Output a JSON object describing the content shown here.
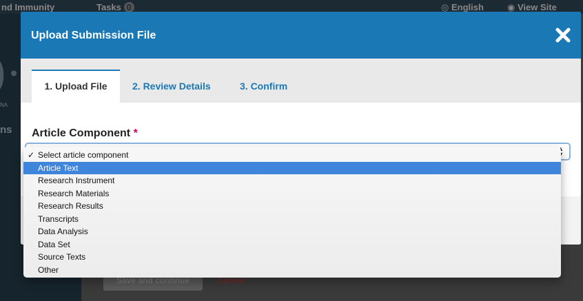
{
  "background": {
    "topbar": {
      "site_name": "nd Immunity",
      "tasks_label": "Tasks",
      "tasks_count": "0",
      "language": "English",
      "view_site": "View Site"
    },
    "sidebar_fragment": "ns",
    "sidebar_tiny": "NA",
    "save_button": "Save and continue",
    "cancel_link": "Cancel"
  },
  "modal": {
    "title": "Upload Submission File",
    "close_icon": "close-x-icon",
    "tabs": [
      {
        "label": "1. Upload File",
        "active": true
      },
      {
        "label": "2. Review Details",
        "active": false
      },
      {
        "label": "3. Confirm",
        "active": false
      }
    ],
    "field": {
      "label": "Article Component",
      "required_mark": "*"
    }
  },
  "dropdown": {
    "options": [
      "Select article component",
      "Article Text",
      "Research Instrument",
      "Research Materials",
      "Research Results",
      "Transcripts",
      "Data Analysis",
      "Data Set",
      "Source Texts",
      "Other"
    ],
    "checked_index": 0,
    "highlighted_index": 1,
    "check_glyph": "✓"
  },
  "colors": {
    "header": "#1a78b4",
    "highlight": "#3f85db",
    "required": "#d00055"
  }
}
